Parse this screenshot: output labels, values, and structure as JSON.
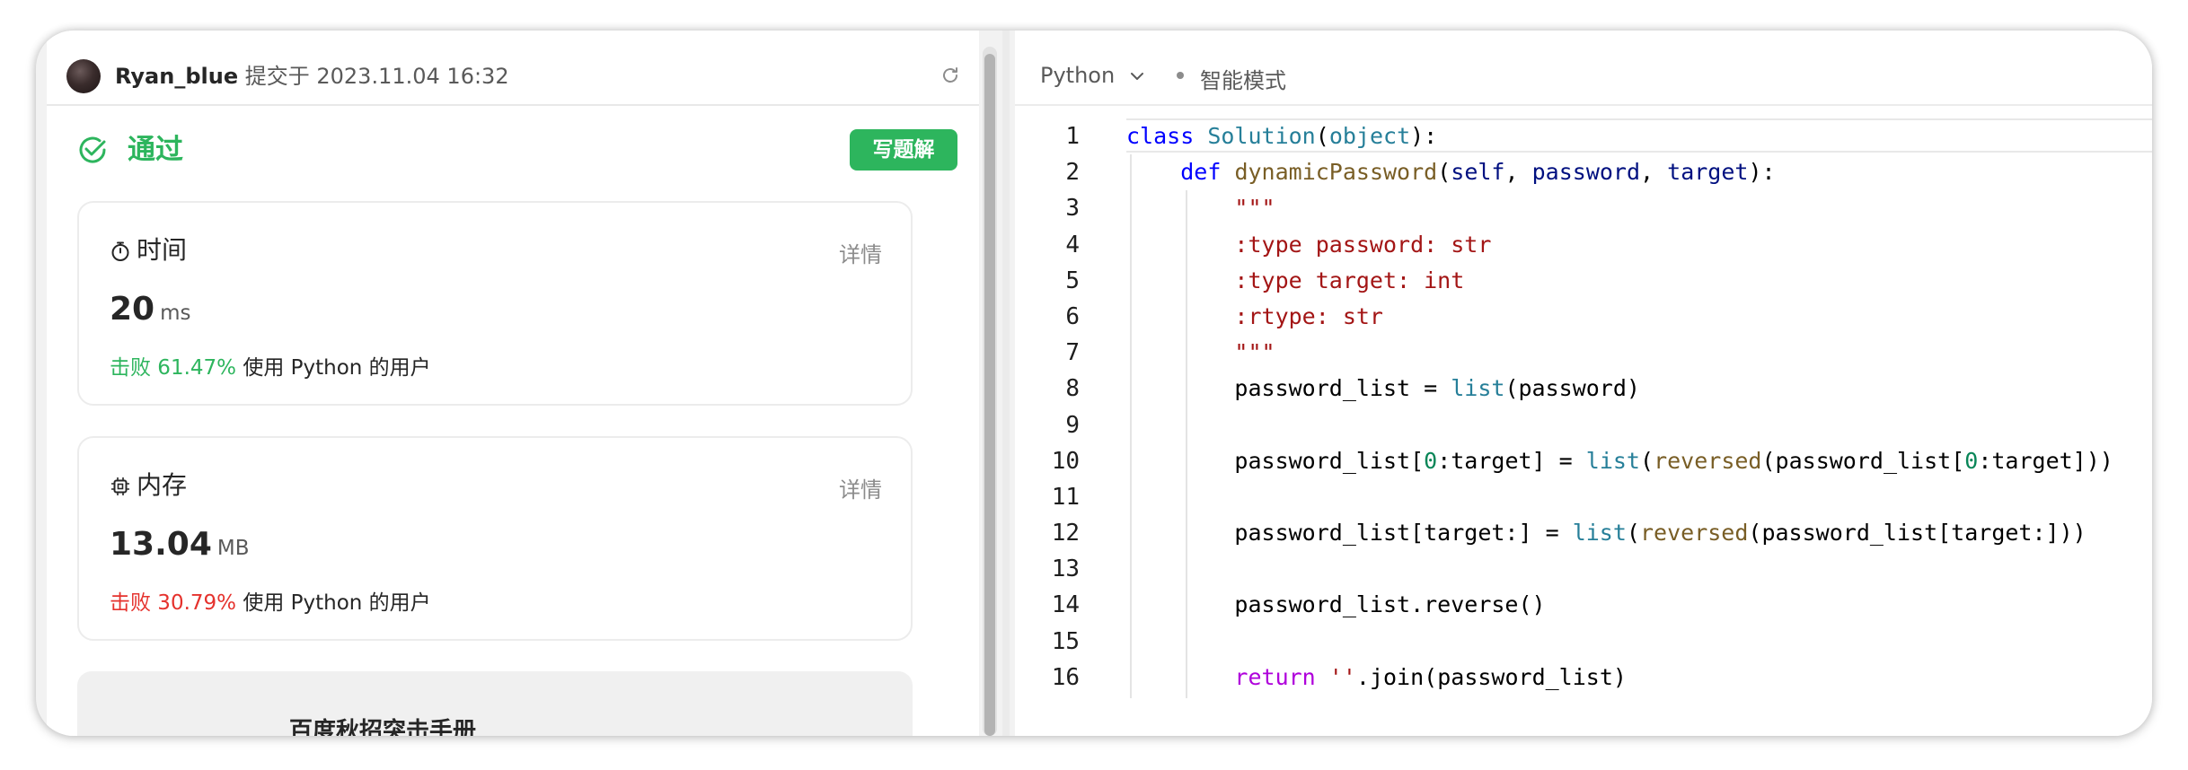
{
  "submission": {
    "user_name": "Ryan_blue",
    "submitted_at": "提交于 2023.11.04 16:32"
  },
  "result": {
    "status": "通过",
    "solution_button": "写题解"
  },
  "runtime": {
    "title": "时间",
    "detail": "详情",
    "value": "20",
    "unit": "ms",
    "beat_percent": "击败 61.47%",
    "beat_suffix": "使用 Python 的用户"
  },
  "memory": {
    "title": "内存",
    "detail": "详情",
    "value": "13.04",
    "unit": "MB",
    "beat_percent": "击败 30.79%",
    "beat_suffix": "使用 Python 的用户"
  },
  "promo": {
    "title": "百度秋招突击手册"
  },
  "editor": {
    "language": "Python",
    "mode": "智能模式",
    "line_numbers": [
      "1",
      "2",
      "3",
      "4",
      "5",
      "6",
      "7",
      "8",
      "9",
      "10",
      "11",
      "12",
      "13",
      "14",
      "15",
      "16"
    ],
    "code_lines": [
      "class Solution(object):",
      "    def dynamicPassword(self, password, target):",
      "        \"\"\"",
      "        :type password: str",
      "        :type target: int",
      "        :rtype: str",
      "        \"\"\"",
      "        password_list = list(password)",
      "",
      "        password_list[0:target] = list(reversed(password_list[0:target]))",
      "",
      "        password_list[target:] = list(reversed(password_list[target:]))",
      "",
      "        password_list.reverse()",
      "",
      "        return ''.join(password_list)"
    ]
  },
  "colors": {
    "accent_green": "#2db55d",
    "beat_red": "#e5322d",
    "keyword": "#0000ff",
    "class_name": "#267f99",
    "function_name": "#795e26",
    "parameter": "#001080",
    "string": "#a31515",
    "number": "#098658",
    "return_keyword": "#af00db"
  },
  "icons": {
    "refresh": "refresh-icon",
    "pass": "check-circle-icon",
    "time": "stopwatch-icon",
    "memory": "chip-icon",
    "language_dropdown": "chevron-down-icon",
    "promo_arrow": "chevron-right-icon"
  }
}
